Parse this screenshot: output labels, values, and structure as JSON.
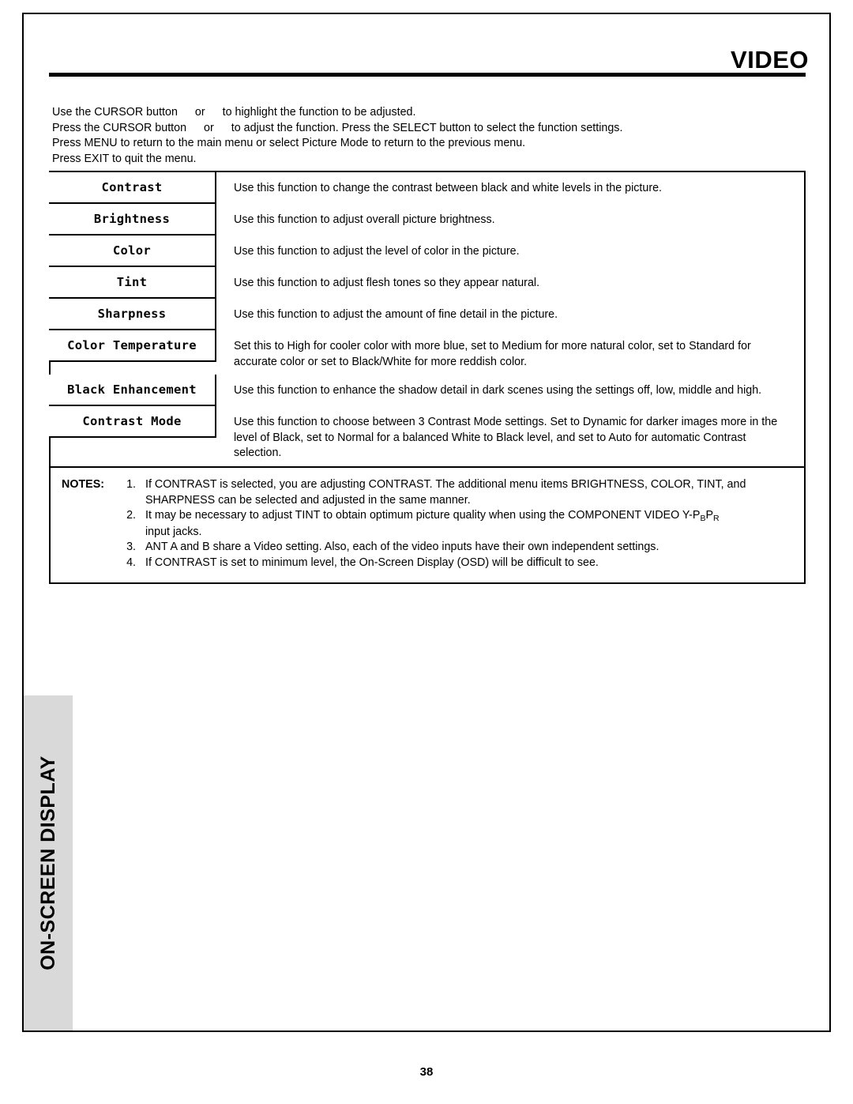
{
  "header": {
    "title": "VIDEO"
  },
  "side_tab": {
    "label": "ON-SCREEN DISPLAY"
  },
  "intro": {
    "line1_a": "Use the CURSOR button",
    "line1_b": "or",
    "line1_c": "to highlight the function to be adjusted.",
    "line2_a": "Press the CURSOR button",
    "line2_b": "or",
    "line2_c": "to adjust the function.  Press the SELECT button to select the function settings.",
    "line3": "Press MENU to return to the main menu or select Picture Mode to return to the previous menu.",
    "line4": "Press EXIT to quit the menu."
  },
  "table": {
    "rows": [
      {
        "label": "Contrast",
        "description": "Use this function to change the contrast between black and white levels in the picture."
      },
      {
        "label": "Brightness",
        "description": "Use this function to adjust overall picture brightness."
      },
      {
        "label": "Color",
        "description": "Use this function to adjust the level of color in the picture."
      },
      {
        "label": "Tint",
        "description": "Use this function to adjust flesh tones so they appear natural."
      },
      {
        "label": "Sharpness",
        "description": "Use this function to adjust the amount of fine detail in the picture."
      },
      {
        "label": "Color Temperature",
        "description": "Set this to High for cooler color with more blue, set to Medium for more natural color, set to Standard for accurate color or set to Black/White for more reddish color."
      },
      {
        "label": "Black Enhancement",
        "description": "Use this function to enhance the shadow detail in dark scenes using the settings off, low, middle and high."
      },
      {
        "label": "Contrast Mode",
        "description": "Use this function to choose between 3 Contrast Mode settings.  Set to Dynamic for darker images more in the level of Black, set to Normal for a balanced White to Black level, and set to Auto for automatic Contrast selection."
      }
    ]
  },
  "notes": {
    "title": "NOTES:",
    "items": [
      {
        "number": "1.",
        "text": "If CONTRAST is selected, you are adjusting CONTRAST.  The additional menu items BRIGHTNESS, COLOR, TINT, and SHARPNESS can be selected and adjusted in the same manner."
      },
      {
        "number": "2.",
        "text_before": "It may be necessary to adjust TINT to obtain optimum picture quality when using the COMPONENT VIDEO Y-P",
        "sub1": "B",
        "text_mid": "P",
        "sub2": "R",
        "text_after": "input jacks."
      },
      {
        "number": "3.",
        "text": "ANT A and B share a Video setting.  Also, each of the video inputs have their own independent settings."
      },
      {
        "number": "4.",
        "text": "If CONTRAST is set to minimum level, the On-Screen Display (OSD) will be difficult to see."
      }
    ]
  },
  "footer": {
    "page_number": "38"
  }
}
